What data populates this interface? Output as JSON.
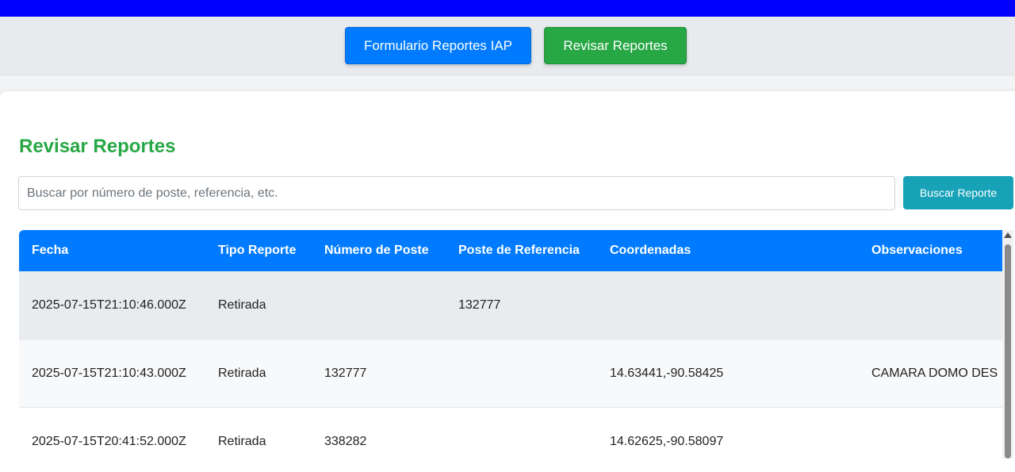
{
  "navbar": {
    "form_button": "Formulario Reportes IAP",
    "review_button": "Revisar Reportes"
  },
  "page": {
    "title": "Revisar Reportes"
  },
  "search": {
    "placeholder": "Buscar por número de poste, referencia, etc.",
    "value": "",
    "button": "Buscar Reporte"
  },
  "table": {
    "headers": [
      "Fecha",
      "Tipo Reporte",
      "Número de Poste",
      "Poste de Referencia",
      "Coordenadas",
      "Observaciones"
    ],
    "rows": [
      [
        "2025-07-15T21:10:46.000Z",
        "Retirada",
        "",
        "132777",
        "",
        ""
      ],
      [
        "2025-07-15T21:10:43.000Z",
        "Retirada",
        "132777",
        "",
        "14.63441,-90.58425",
        "CAMARA DOMO DES"
      ],
      [
        "2025-07-15T20:41:52.000Z",
        "Retirada",
        "338282",
        "",
        "14.62625,-90.58097",
        ""
      ]
    ]
  },
  "colors": {
    "top_bar": "#0000ff",
    "primary": "#007bff",
    "success": "#28a745",
    "info": "#17a2b8"
  }
}
